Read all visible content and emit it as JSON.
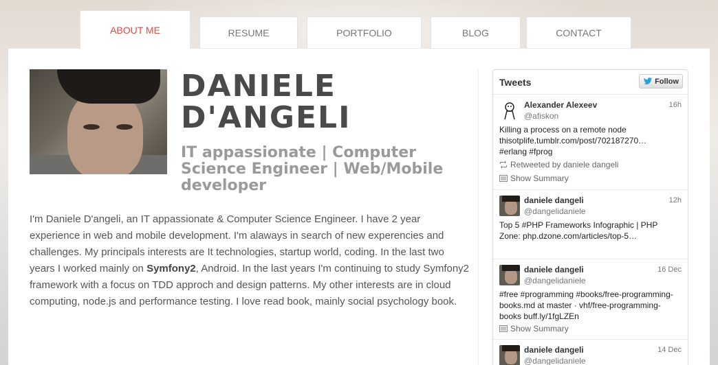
{
  "nav": {
    "tabs": [
      {
        "label": "ABOUT ME",
        "active": true
      },
      {
        "label": "RESUME"
      },
      {
        "label": "PORTFOLIO"
      },
      {
        "label": "BLOG"
      },
      {
        "label": "CONTACT"
      }
    ]
  },
  "profile": {
    "name_line1": "DANIELE",
    "name_line2": "D'ANGELI",
    "subtitle": "IT appassionate | Computer Science Engineer | Web/Mobile developer",
    "bio_part1": "I'm Daniele D'angeli, an IT appassionate & Computer Science Engineer. I have 2 year experience in web and mobile development. I'm alaways in search of new experencies and challenges. My principals interests are It technologies, startup world, coding. In the last two years I worked mainly on ",
    "bio_bold": "Symfony2",
    "bio_part2": ", Android. In the last years I'm continuing to study Symfony2 framework with a focus on TDD approch and design patterns. My other interests are in cloud computing, node.js and performance testing. I love read book, mainly social psychology book."
  },
  "tweets_widget": {
    "title": "Tweets",
    "follow_label": "Follow",
    "tweets": [
      {
        "name": "Alexander Alexeev",
        "handle": "@afiskon",
        "time": "16h",
        "text_lines": [
          "Killing a process on a remote node",
          " thisotplife.tumblr.com/post/702187270…",
          " #erlang #fprog"
        ],
        "retweet": "Retweeted by daniele dangeli",
        "summary": "Show Summary"
      },
      {
        "name": "daniele dangeli",
        "handle": "@dangelidaniele",
        "time": "12h",
        "text_lines": [
          "Top 5 #PHP Frameworks Infographic | PHP",
          "Zone: php.dzone.com/articles/top-5…"
        ]
      },
      {
        "name": "daniele dangeli",
        "handle": "@dangelidaniele",
        "time": "16 Dec",
        "text_lines": [
          "#free #programming #books/free-programming-",
          "books.md at master · vhf/free-programming-",
          "books buff.ly/1fgLZEn"
        ],
        "summary": "Show Summary"
      },
      {
        "name": "daniele dangeli",
        "handle": "@dangelidaniele",
        "time": "14 Dec"
      }
    ]
  },
  "colors": {
    "accent": "#e14a3b",
    "text": "#555555",
    "heading": "#4a4a4a"
  }
}
